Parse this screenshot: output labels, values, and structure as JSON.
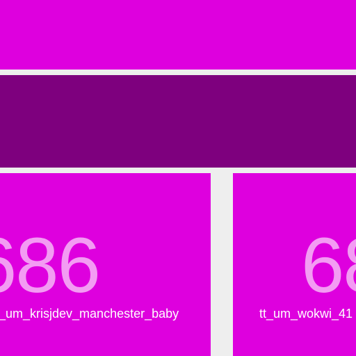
{
  "colors": {
    "background": "#eeeeee",
    "band_top": "#de00de",
    "band_mid": "#7e007e",
    "tile": "#de00de",
    "tile_number_text": "#f39cf3",
    "tile_name_text": "#ffffff"
  },
  "tiles": [
    {
      "number": "686",
      "name": "tt_um_krisjdev_manchester_baby"
    },
    {
      "number": "68",
      "name": "tt_um_wokwi_41"
    }
  ]
}
